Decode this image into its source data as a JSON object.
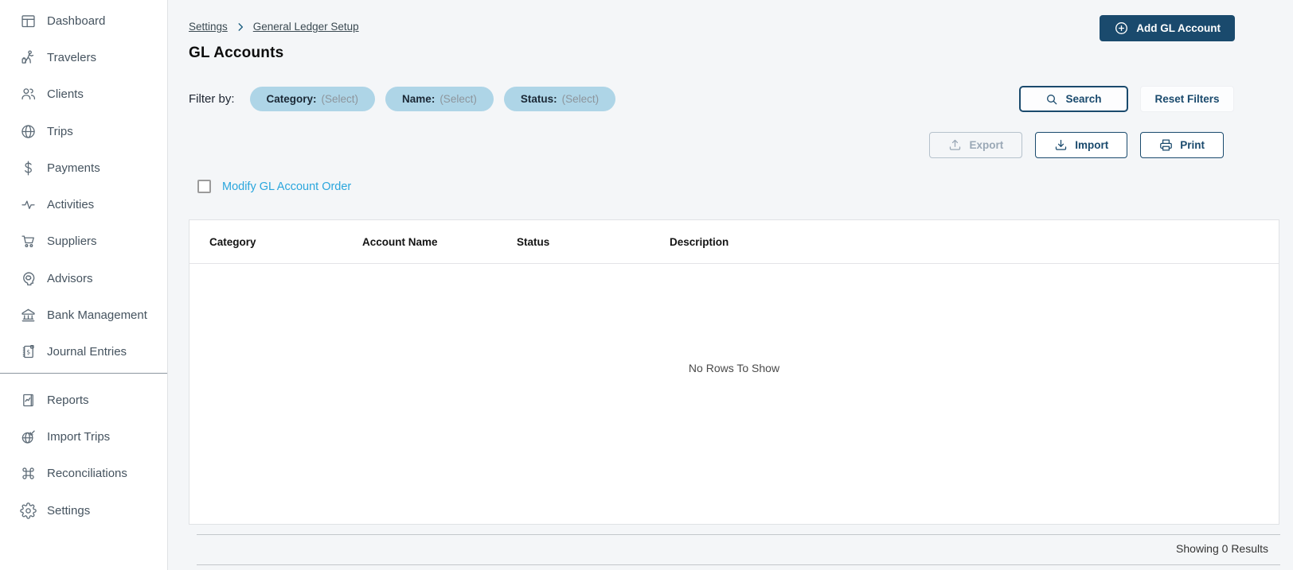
{
  "sidebar": {
    "items": [
      {
        "label": "Dashboard",
        "icon": "dashboard-icon"
      },
      {
        "label": "Travelers",
        "icon": "traveler-icon"
      },
      {
        "label": "Clients",
        "icon": "people-icon"
      },
      {
        "label": "Trips",
        "icon": "globe-icon"
      },
      {
        "label": "Payments",
        "icon": "dollar-icon"
      },
      {
        "label": "Activities",
        "icon": "pulse-icon"
      },
      {
        "label": "Suppliers",
        "icon": "cart-icon"
      },
      {
        "label": "Advisors",
        "icon": "advisor-icon"
      },
      {
        "label": "Bank Management",
        "icon": "bank-icon"
      },
      {
        "label": "Journal Entries",
        "icon": "journal-icon"
      },
      {
        "label": "Reports",
        "icon": "report-icon"
      },
      {
        "label": "Import Trips",
        "icon": "import-globe-icon"
      },
      {
        "label": "Reconciliations",
        "icon": "command-icon"
      },
      {
        "label": "Settings",
        "icon": "gear-icon"
      }
    ]
  },
  "breadcrumb": {
    "items": [
      "Settings",
      "General Ledger Setup"
    ]
  },
  "page": {
    "title": "GL Accounts"
  },
  "header": {
    "add_button": "Add GL Account"
  },
  "filters": {
    "label": "Filter by:",
    "pills": [
      {
        "name": "Category:",
        "value": "(Select)"
      },
      {
        "name": "Name:",
        "value": "(Select)"
      },
      {
        "name": "Status:",
        "value": "(Select)"
      }
    ],
    "search_button": "Search",
    "reset_button": "Reset Filters"
  },
  "actions": {
    "export_button": "Export",
    "export_enabled": false,
    "import_button": "Import",
    "print_button": "Print"
  },
  "order_toggle": {
    "label": "Modify GL Account Order",
    "checked": false
  },
  "table": {
    "columns": [
      "Category",
      "Account Name",
      "Status",
      "Description"
    ],
    "rows": [],
    "empty_message": "No Rows To Show"
  },
  "footer": {
    "summary": "Showing 0 Results"
  },
  "colors": {
    "accent_navy": "#1a4a6d",
    "pill_blue": "#aed5e7",
    "link_blue": "#2aa6dd",
    "page_bg": "#f4f6f8",
    "sidebar_bg": "#ffffff"
  }
}
